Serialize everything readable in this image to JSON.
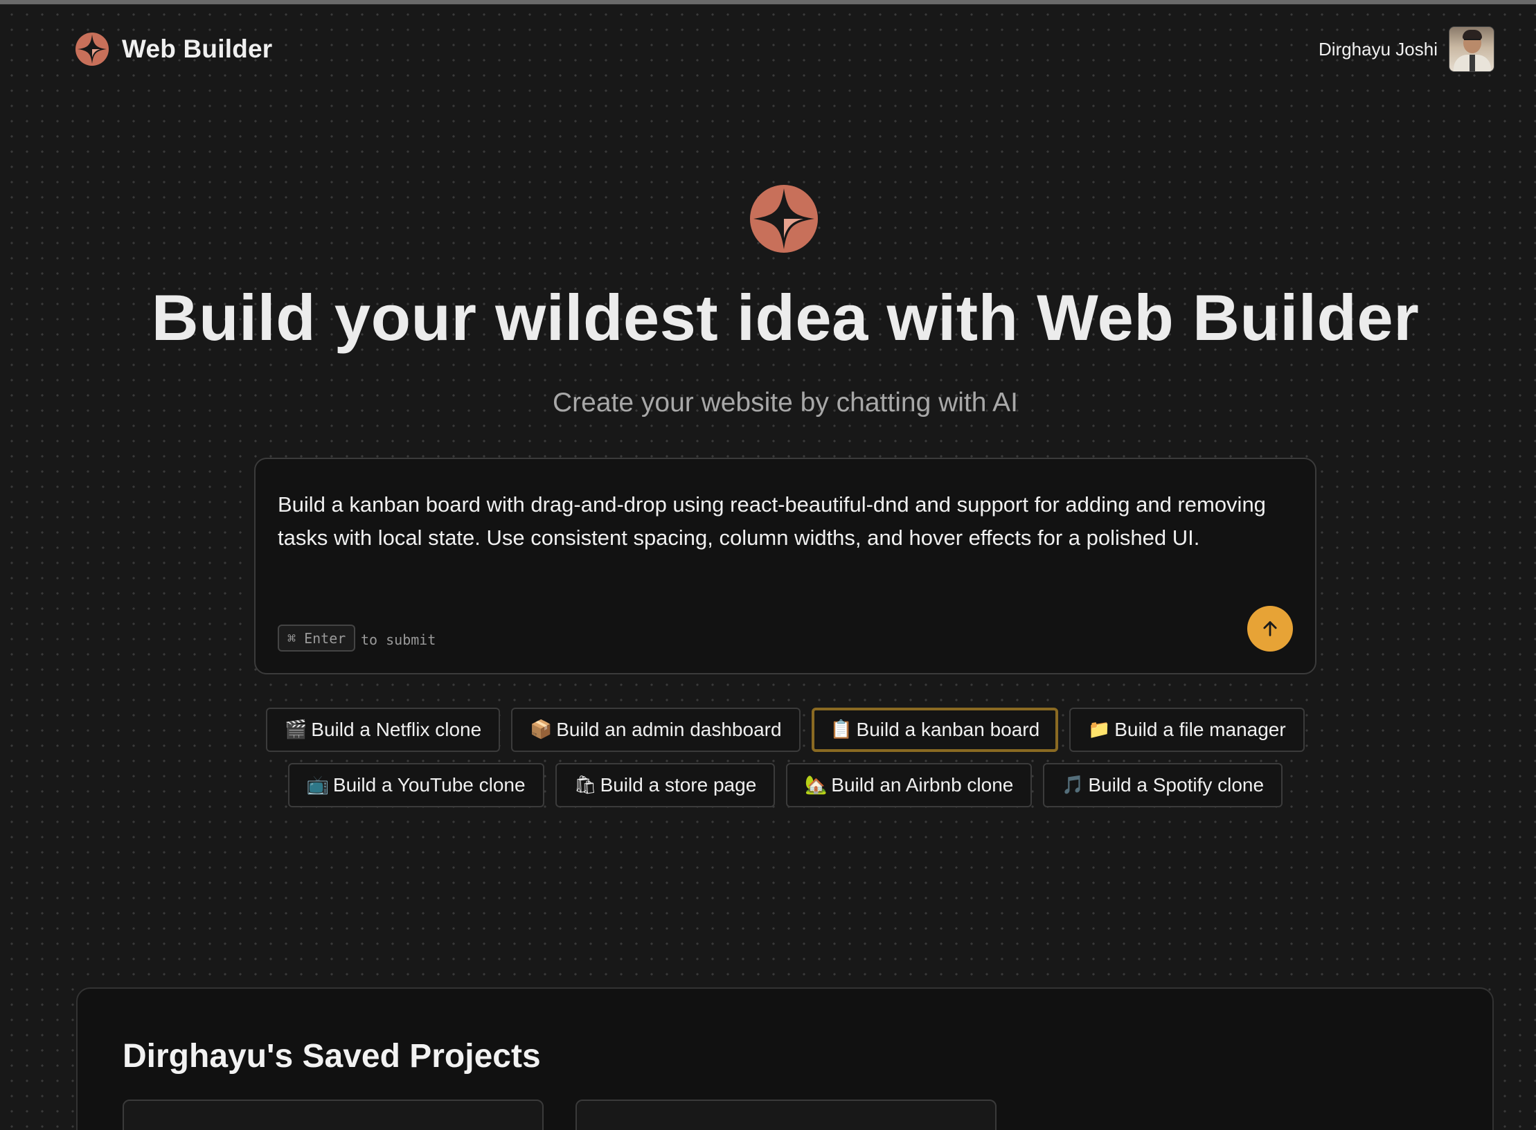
{
  "app": {
    "name": "Web Builder",
    "accent_color": "#e7a336",
    "logo_color": "#c8705a"
  },
  "user": {
    "name": "Dirghayu Joshi"
  },
  "hero": {
    "title": "Build your wildest idea with Web Builder",
    "subtitle": "Create your website by chatting with AI"
  },
  "prompt": {
    "value": "Build a kanban board with drag-and-drop using react-beautiful-dnd and support for adding and removing tasks with local state. Use consistent spacing, column widths, and hover effects for a polished UI.",
    "shortcut_key": "⌘ Enter",
    "shortcut_hint": "to submit",
    "submit_icon": "arrow-up-icon"
  },
  "suggestions": {
    "row1": [
      {
        "emoji": "🎬",
        "label": "Build a Netflix clone"
      },
      {
        "emoji": "📦",
        "label": "Build an admin dashboard"
      },
      {
        "emoji": "📋",
        "label": "Build a kanban board",
        "active": true
      },
      {
        "emoji": "📁",
        "label": "Build a file manager"
      }
    ],
    "row2": [
      {
        "emoji": "📺",
        "label": "Build a YouTube clone"
      },
      {
        "emoji": "🛍",
        "label": "Build a store page"
      },
      {
        "emoji": "🏡",
        "label": "Build an Airbnb clone"
      },
      {
        "emoji": "🎵",
        "label": "Build a Spotify clone"
      }
    ]
  },
  "saved_projects": {
    "title": "Dirghayu's Saved Projects"
  }
}
